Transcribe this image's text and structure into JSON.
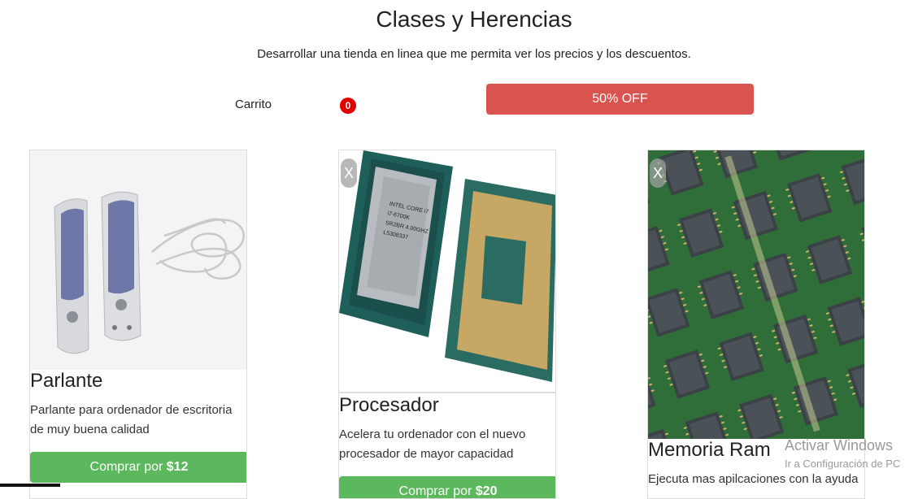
{
  "header": {
    "title": "Clases y Herencias",
    "subtitle": "Desarrollar una tienda en linea que me permita ver los precios y los descuentos."
  },
  "cart": {
    "label": "Carrito",
    "count": "0"
  },
  "discount_button": {
    "label": "50% OFF"
  },
  "products": [
    {
      "name": "Parlante",
      "description": "Parlante para ordenador de escritoria de muy buena calidad",
      "buy_prefix": "Comprar por ",
      "price": "$12",
      "image_icon": "speakers-image"
    },
    {
      "name": "Procesador",
      "description": "Acelera tu ordenador con el nuevo procesador de mayor capacidad",
      "buy_prefix": "Comprar por ",
      "price": "$20",
      "close_label": "X",
      "image_icon": "cpu-image"
    },
    {
      "name": "Memoria Ram",
      "description": "Ejecuta mas apilcaciones con la ayuda",
      "close_label": "X",
      "image_icon": "ram-board-image"
    }
  ],
  "watermark": {
    "line1": "Activar Windows",
    "line2": "Ir a Configuración de PC"
  },
  "colors": {
    "discount": "#d9534f",
    "buy": "#5cb85c",
    "badge": "#e00000"
  }
}
